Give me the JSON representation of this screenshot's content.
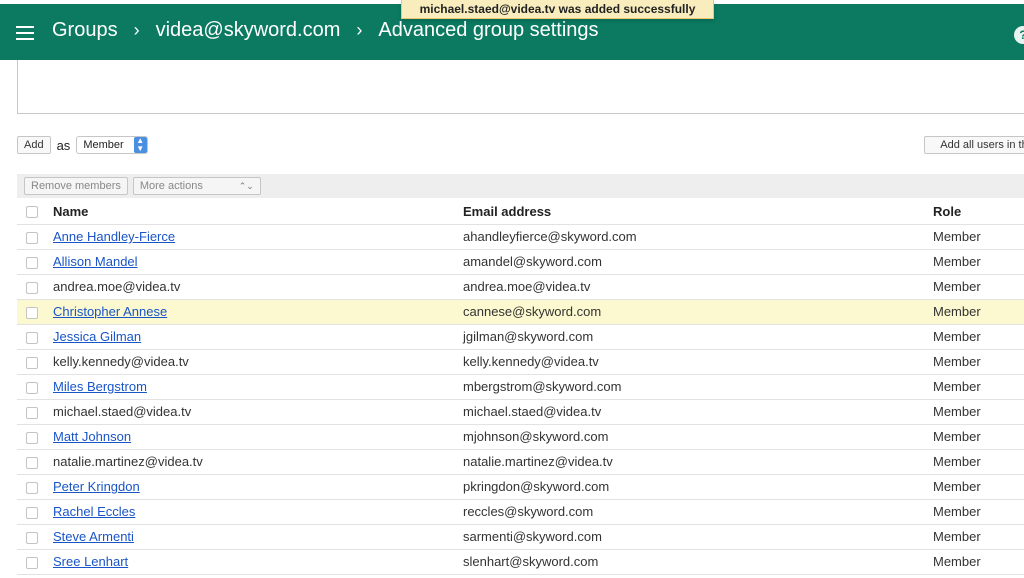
{
  "header": {
    "breadcrumbs": [
      "Groups",
      "videa@skyword.com",
      "Advanced group settings"
    ],
    "separator": "›",
    "help_glyph": "?"
  },
  "toast": {
    "message": "michael.staed@videa.tv was added successfully"
  },
  "add_bar": {
    "add_label": "Add",
    "as_label": "as",
    "role_selected": "Member",
    "add_all_label": "Add all users in th"
  },
  "toolbar": {
    "remove_label": "Remove members",
    "more_actions_label": "More actions"
  },
  "table": {
    "headers": {
      "name": "Name",
      "email": "Email address",
      "role": "Role"
    },
    "rows": [
      {
        "name": "Anne Handley-Fierce",
        "is_link": true,
        "email": "ahandleyfierce@skyword.com",
        "role": "Member"
      },
      {
        "name": "Allison Mandel",
        "is_link": true,
        "email": "amandel@skyword.com",
        "role": "Member"
      },
      {
        "name": "andrea.moe@videa.tv",
        "is_link": false,
        "email": "andrea.moe@videa.tv",
        "role": "Member"
      },
      {
        "name": "Christopher Annese",
        "is_link": true,
        "email": "cannese@skyword.com",
        "role": "Member",
        "highlight": true
      },
      {
        "name": "Jessica Gilman",
        "is_link": true,
        "email": "jgilman@skyword.com",
        "role": "Member"
      },
      {
        "name": "kelly.kennedy@videa.tv",
        "is_link": false,
        "email": "kelly.kennedy@videa.tv",
        "role": "Member"
      },
      {
        "name": "Miles Bergstrom",
        "is_link": true,
        "email": "mbergstrom@skyword.com",
        "role": "Member"
      },
      {
        "name": "michael.staed@videa.tv",
        "is_link": false,
        "email": "michael.staed@videa.tv",
        "role": "Member"
      },
      {
        "name": "Matt Johnson",
        "is_link": true,
        "email": "mjohnson@skyword.com",
        "role": "Member"
      },
      {
        "name": "natalie.martinez@videa.tv",
        "is_link": false,
        "email": "natalie.martinez@videa.tv",
        "role": "Member"
      },
      {
        "name": "Peter Kringdon",
        "is_link": true,
        "email": "pkringdon@skyword.com",
        "role": "Member"
      },
      {
        "name": "Rachel Eccles",
        "is_link": true,
        "email": "reccles@skyword.com",
        "role": "Member"
      },
      {
        "name": "Steve Armenti",
        "is_link": true,
        "email": "sarmenti@skyword.com",
        "role": "Member"
      },
      {
        "name": "Sree Lenhart",
        "is_link": true,
        "email": "slenhart@skyword.com",
        "role": "Member"
      }
    ]
  },
  "colors": {
    "header": "#0b7a61",
    "link": "#1a55c8",
    "highlight_row": "#fcf8cf",
    "toast": "#f9edbe"
  }
}
